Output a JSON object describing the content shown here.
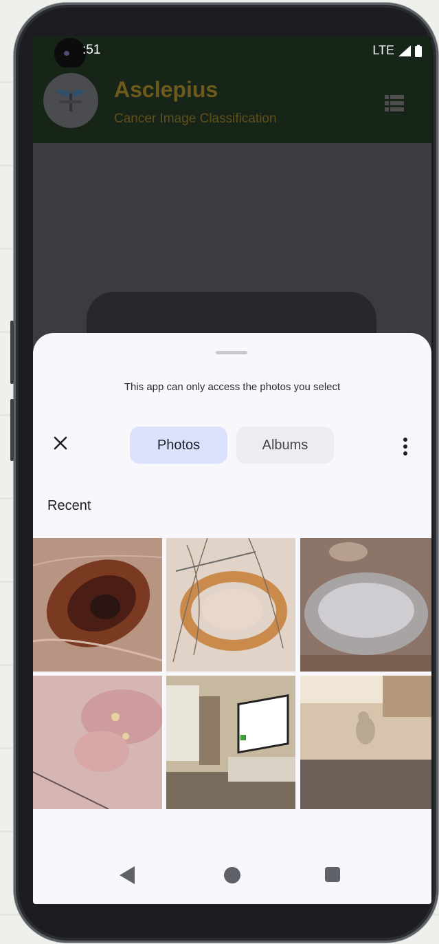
{
  "status_bar": {
    "time": ":51",
    "network": "LTE"
  },
  "app_bar": {
    "title": "Asclepius",
    "subtitle": "Cancer Image Classification"
  },
  "picker": {
    "info_text": "This app can only access the photos you select",
    "tabs": [
      {
        "label": "Photos",
        "selected": true
      },
      {
        "label": "Albums",
        "selected": false
      }
    ],
    "section_label": "Recent",
    "photos": [
      {
        "icon": "skin-lesion-dark-mole-photo"
      },
      {
        "icon": "skin-lesion-ring-with-ruler-photo"
      },
      {
        "icon": "skin-lesion-crusted-closeup-photo"
      },
      {
        "icon": "skin-rash-with-ruler-photo"
      },
      {
        "icon": "living-room-tv-checkerboard-photo"
      },
      {
        "icon": "room-with-cat-on-floor-photo"
      }
    ]
  },
  "nav_bar": {
    "icons": [
      "back-icon",
      "home-icon",
      "recents-icon"
    ]
  },
  "colors": {
    "app_bar_bg": "#172418",
    "sheet_bg": "#f7f7fc",
    "selected_tab_bg": "#dbe1fa",
    "title_dimmed": "#6d5a1c"
  }
}
